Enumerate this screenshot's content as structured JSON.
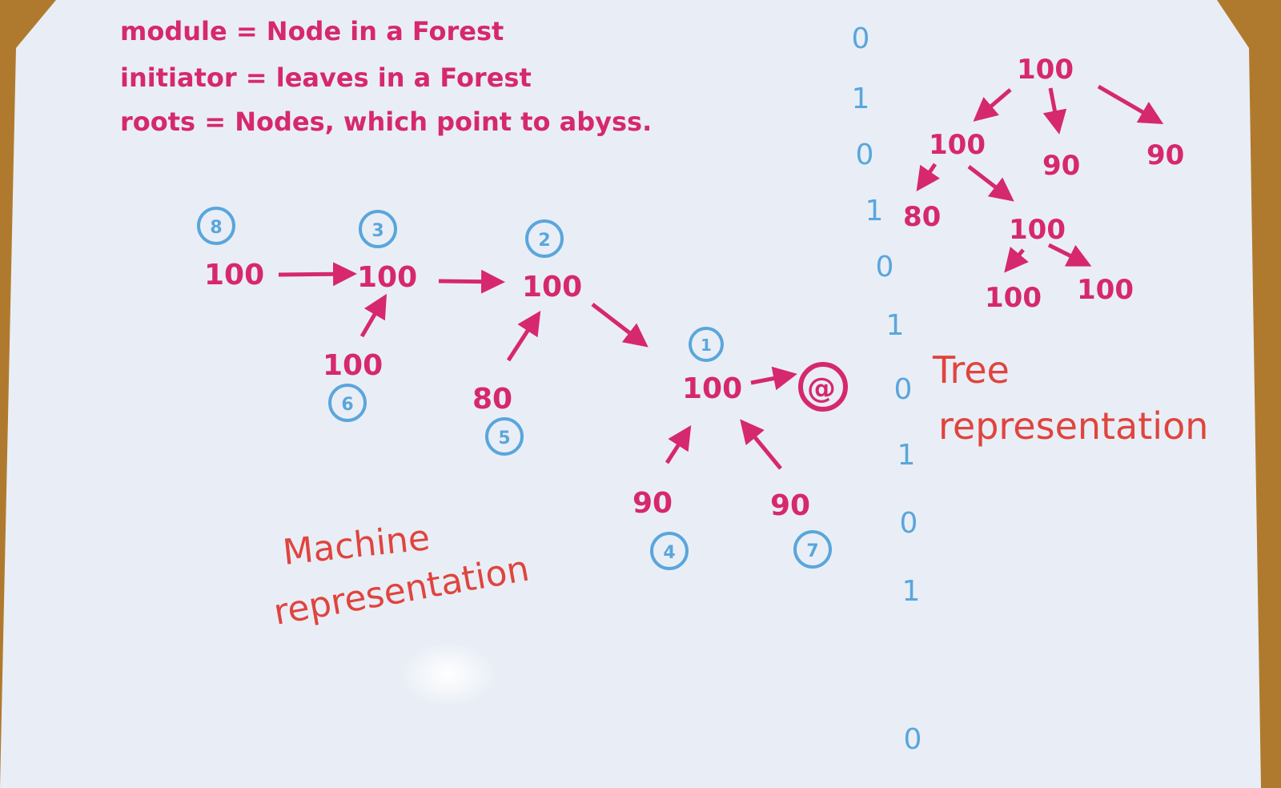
{
  "colors": {
    "magenta": "#d6286e",
    "red": "#e0443e",
    "blue": "#5aa6dc",
    "board": "#e9eef6",
    "frame": "#b07a2e"
  },
  "notes": {
    "line1": "module = Node in a Forest",
    "line2": "initiator = leaves in a Forest",
    "line3": "roots = Nodes, which point to abyss."
  },
  "machine": {
    "title_line1": "Machine",
    "title_line2": "representation",
    "nodes": [
      {
        "value": "100",
        "id": "8"
      },
      {
        "value": "100",
        "id": "3"
      },
      {
        "value": "100",
        "id": "2"
      },
      {
        "value": "100",
        "id": "6"
      },
      {
        "value": "80",
        "id": "5"
      },
      {
        "value": "100",
        "id": "1"
      },
      {
        "value": "90",
        "id": "4"
      },
      {
        "value": "90",
        "id": "7"
      }
    ],
    "abyss_symbol": "@"
  },
  "divider": [
    "0",
    "1",
    "0",
    "1",
    "0",
    "1",
    "0",
    "1",
    "0",
    "1",
    "0"
  ],
  "tree": {
    "title_line1": "Tree",
    "title_line2": "representation",
    "root": "100",
    "level1": [
      "100",
      "90",
      "90"
    ],
    "level2": [
      "80",
      "100"
    ],
    "level3": [
      "100",
      "100"
    ]
  }
}
